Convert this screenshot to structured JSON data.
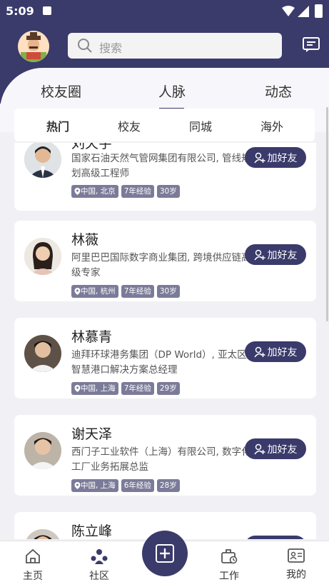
{
  "status_bar": {
    "time": "5:09"
  },
  "search": {
    "placeholder": "搜索"
  },
  "top_tabs": [
    {
      "label": "校友圈"
    },
    {
      "label": "人脉"
    },
    {
      "label": "动态"
    }
  ],
  "sub_tabs": [
    {
      "label": "热门"
    },
    {
      "label": "校友"
    },
    {
      "label": "同城"
    },
    {
      "label": "海外"
    }
  ],
  "add_friend_label": "加好友",
  "people": [
    {
      "name": "刘天宇",
      "company": "国家石油天然气管网集团有限公司, 管线规划高级工程师",
      "location": "中国, 北京",
      "experience": "7年经验",
      "age": "30岁"
    },
    {
      "name": "林薇",
      "company": "阿里巴巴国际数字商业集团, 跨境供应链高级专家",
      "location": "中国, 杭州",
      "experience": "7年经验",
      "age": "30岁"
    },
    {
      "name": "林慕青",
      "company": "迪拜环球港务集团（DP World）, 亚太区智慧港口解决方案总经理",
      "location": "中国, 上海",
      "experience": "7年经验",
      "age": "29岁"
    },
    {
      "name": "谢天泽",
      "company": "西门子工业软件（上海）有限公司, 数字化工厂业务拓展总监",
      "location": "中国, 上海",
      "experience": "6年经验",
      "age": "28岁"
    },
    {
      "name": "陈立峰",
      "company": "",
      "location": "",
      "experience": "",
      "age": ""
    }
  ],
  "bottom_nav": [
    {
      "label": "主页"
    },
    {
      "label": "社区"
    },
    {
      "label": "工作"
    },
    {
      "label": "我的"
    }
  ],
  "colors": {
    "primary": "#3a3a6b",
    "tag": "#7b7b99"
  }
}
